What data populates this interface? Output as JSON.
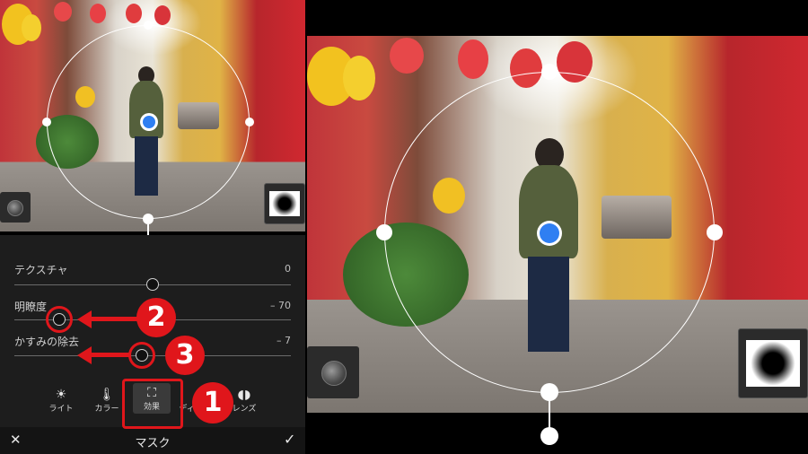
{
  "panel": {
    "rows": [
      {
        "label": "テクスチャ",
        "value": "0"
      },
      {
        "label": "明瞭度",
        "value": "– 70"
      },
      {
        "label": "かすみの除去",
        "value": "– 7"
      }
    ],
    "tabs": [
      {
        "label": "ライト",
        "icon": "sun-icon"
      },
      {
        "label": "カラー",
        "icon": "thermometer-icon"
      },
      {
        "label": "効果",
        "icon": "effects-icon"
      },
      {
        "label": "ディ",
        "icon": "detail-icon"
      },
      {
        "label": "レンズ",
        "icon": "lens-icon"
      }
    ],
    "title": "マスク"
  },
  "annotations": {
    "badge1": "1",
    "badge2": "2",
    "badge3": "3"
  },
  "colors": {
    "annotation_red": "#e0161b",
    "pin_blue": "#2f7ff2"
  }
}
